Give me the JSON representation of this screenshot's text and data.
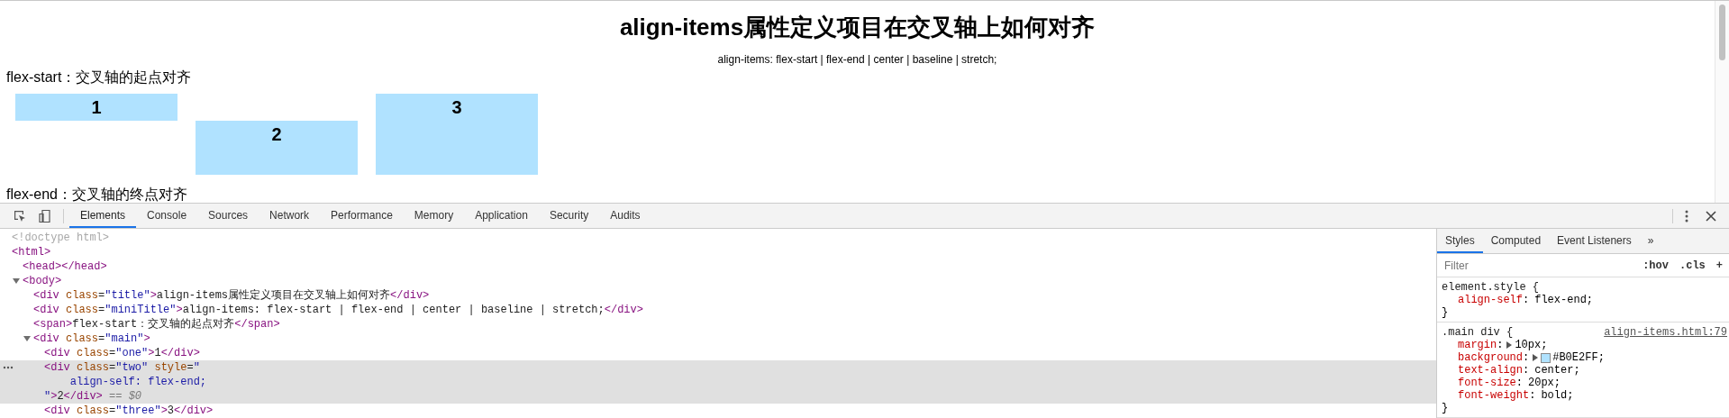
{
  "page": {
    "title": "align-items属性定义项目在交叉轴上如何对齐",
    "subtitle": "align-items: flex-start | flex-end | center | baseline | stretch;",
    "sections": [
      {
        "label": "flex-start：交叉轴的起点对齐",
        "boxes": [
          {
            "label": "1"
          },
          {
            "label": "2"
          },
          {
            "label": "3"
          }
        ]
      },
      {
        "label": "flex-end：交叉轴的终点对齐"
      }
    ]
  },
  "devtools": {
    "tabs": [
      {
        "label": "Elements",
        "selected": true
      },
      {
        "label": "Console",
        "selected": false
      },
      {
        "label": "Sources",
        "selected": false
      },
      {
        "label": "Network",
        "selected": false
      },
      {
        "label": "Performance",
        "selected": false
      },
      {
        "label": "Memory",
        "selected": false
      },
      {
        "label": "Application",
        "selected": false
      },
      {
        "label": "Security",
        "selected": false
      },
      {
        "label": "Audits",
        "selected": false
      }
    ],
    "nodes": [
      {
        "selected": false,
        "lines": [
          [
            {
              "kind": "doctype",
              "text": "<!doctype html>"
            }
          ]
        ]
      },
      {
        "selected": false,
        "lines": [
          [
            {
              "kind": "tag",
              "text": "<html>"
            }
          ]
        ],
        "children": [
          {
            "selected": false,
            "lines": [
              [
                {
                  "kind": "tag",
                  "text": "<head></head>"
                }
              ]
            ]
          },
          {
            "selected": false,
            "expanded": true,
            "lines": [
              [
                {
                  "kind": "tag",
                  "text": "<body>"
                }
              ]
            ],
            "children": [
              {
                "selected": false,
                "lines": [
                  [
                    {
                      "kind": "tag",
                      "text": "<div"
                    },
                    {
                      "kind": "attr",
                      "text": " class"
                    },
                    {
                      "kind": "punct",
                      "text": "="
                    },
                    {
                      "kind": "val",
                      "text": "\"title\""
                    },
                    {
                      "kind": "tag",
                      "text": ">"
                    },
                    {
                      "kind": "text",
                      "text": "align-items属性定义项目在交叉轴上如何对齐"
                    },
                    {
                      "kind": "tag",
                      "text": "</div>"
                    }
                  ]
                ]
              },
              {
                "selected": false,
                "lines": [
                  [
                    {
                      "kind": "tag",
                      "text": "<div"
                    },
                    {
                      "kind": "attr",
                      "text": " class"
                    },
                    {
                      "kind": "punct",
                      "text": "="
                    },
                    {
                      "kind": "val",
                      "text": "\"miniTitle\""
                    },
                    {
                      "kind": "tag",
                      "text": ">"
                    },
                    {
                      "kind": "text",
                      "text": "align-items: flex-start | flex-end | center | baseline | stretch;"
                    },
                    {
                      "kind": "tag",
                      "text": "</div>"
                    }
                  ]
                ]
              },
              {
                "selected": false,
                "lines": [
                  [
                    {
                      "kind": "tag",
                      "text": "<span>"
                    },
                    {
                      "kind": "text",
                      "text": "flex-start：交叉轴的起点对齐"
                    },
                    {
                      "kind": "tag",
                      "text": "</span>"
                    }
                  ]
                ]
              },
              {
                "selected": false,
                "expanded": true,
                "lines": [
                  [
                    {
                      "kind": "tag",
                      "text": "<div"
                    },
                    {
                      "kind": "attr",
                      "text": " class"
                    },
                    {
                      "kind": "punct",
                      "text": "="
                    },
                    {
                      "kind": "val",
                      "text": "\"main\""
                    },
                    {
                      "kind": "tag",
                      "text": ">"
                    }
                  ]
                ],
                "children": [
                  {
                    "selected": false,
                    "lines": [
                      [
                        {
                          "kind": "tag",
                          "text": "<div"
                        },
                        {
                          "kind": "attr",
                          "text": " class"
                        },
                        {
                          "kind": "punct",
                          "text": "="
                        },
                        {
                          "kind": "val",
                          "text": "\"one\""
                        },
                        {
                          "kind": "tag",
                          "text": ">"
                        },
                        {
                          "kind": "text",
                          "text": "1"
                        },
                        {
                          "kind": "tag",
                          "text": "</div>"
                        }
                      ]
                    ]
                  },
                  {
                    "selected": true,
                    "lines": [
                      [
                        {
                          "kind": "tag",
                          "text": "<div"
                        },
                        {
                          "kind": "attr",
                          "text": " class"
                        },
                        {
                          "kind": "punct",
                          "text": "="
                        },
                        {
                          "kind": "val",
                          "text": "\"two\""
                        },
                        {
                          "kind": "attr",
                          "text": " style"
                        },
                        {
                          "kind": "punct",
                          "text": "="
                        },
                        {
                          "kind": "val",
                          "text": "\""
                        }
                      ],
                      [
                        {
                          "kind": "val",
                          "text": "    align-self: flex-end;"
                        }
                      ],
                      [
                        {
                          "kind": "val",
                          "text": "\""
                        },
                        {
                          "kind": "tag",
                          "text": ">"
                        },
                        {
                          "kind": "text",
                          "text": "2"
                        },
                        {
                          "kind": "tag",
                          "text": "</div>"
                        },
                        {
                          "kind": "marker",
                          "text": " == $0"
                        }
                      ]
                    ]
                  },
                  {
                    "selected": false,
                    "lines": [
                      [
                        {
                          "kind": "tag",
                          "text": "<div"
                        },
                        {
                          "kind": "attr",
                          "text": " class"
                        },
                        {
                          "kind": "punct",
                          "text": "="
                        },
                        {
                          "kind": "val",
                          "text": "\"three\""
                        },
                        {
                          "kind": "tag",
                          "text": ">"
                        },
                        {
                          "kind": "text",
                          "text": "3"
                        },
                        {
                          "kind": "tag",
                          "text": "</div>"
                        }
                      ]
                    ]
                  }
                ]
              }
            ]
          }
        ]
      }
    ]
  },
  "styles": {
    "tabs": [
      {
        "label": "Styles",
        "selected": true
      },
      {
        "label": "Computed",
        "selected": false
      },
      {
        "label": "Event Listeners",
        "selected": false
      },
      {
        "label": "»",
        "selected": false
      }
    ],
    "filter": {
      "placeholder": "Filter"
    },
    "buttons": [
      ":hov",
      ".cls",
      "+"
    ],
    "rules": [
      {
        "selector": "element.style {",
        "close": "}",
        "props": [
          {
            "name": "align-self",
            "colon": ":",
            "value": "flex-end;",
            "expandable": false
          }
        ]
      },
      {
        "selector": ".main div {",
        "source": "align-items.html:79",
        "close": "}",
        "props": [
          {
            "name": "margin",
            "colon": ":",
            "value": "10px;",
            "expandable": true
          },
          {
            "name": "background",
            "colon": ":",
            "value": "#B0E2FF;",
            "expandable": true,
            "color": "#b0e2ff"
          },
          {
            "name": "text-align",
            "colon": ":",
            "value": "center;",
            "expandable": false
          },
          {
            "name": "font-size",
            "colon": ":",
            "value": "20px;",
            "expandable": false
          },
          {
            "name": "font-weight",
            "colon": ":",
            "value": "bold;",
            "expandable": false
          }
        ]
      }
    ]
  }
}
